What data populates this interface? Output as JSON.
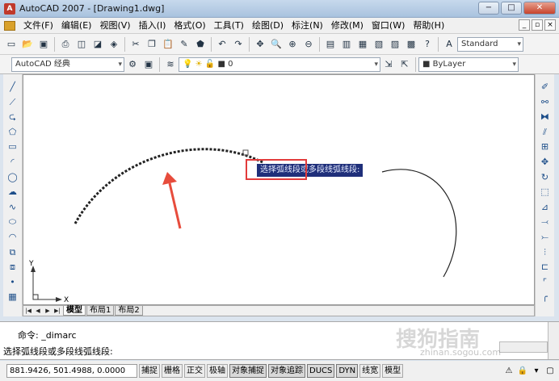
{
  "window": {
    "title": "AutoCAD 2007 - [Drawing1.dwg]"
  },
  "menu": {
    "items": [
      "文件(F)",
      "编辑(E)",
      "视图(V)",
      "插入(I)",
      "格式(O)",
      "工具(T)",
      "绘图(D)",
      "标注(N)",
      "修改(M)",
      "窗口(W)",
      "帮助(H)"
    ]
  },
  "toolbar": {
    "text_style": "Standard",
    "workspace": "AutoCAD 经典",
    "layer": "0",
    "linetype": "ByLayer"
  },
  "canvas": {
    "tooltip": "选择弧线段或多段线弧线段:",
    "ucs_x": "X",
    "ucs_y": "Y"
  },
  "tabs": {
    "model": "模型",
    "layout1": "布局1",
    "layout2": "布局2"
  },
  "command": {
    "history": "命令: _dimarc",
    "prompt": "选择弧线段或多段线弧线段:"
  },
  "status": {
    "coords": "881.9426, 501.4988, 0.0000",
    "buttons": [
      "捕捉",
      "栅格",
      "正交",
      "极轴",
      "对象捕捉",
      "对象追踪",
      "DUCS",
      "DYN",
      "线宽",
      "模型"
    ]
  },
  "watermark": {
    "text": "搜狗指南",
    "url": "zhinan.sogou.com"
  },
  "colors": {
    "highlight": "#e23b3b",
    "arrow": "#e74c3c",
    "tooltip_bg": "#1f2f7a"
  }
}
